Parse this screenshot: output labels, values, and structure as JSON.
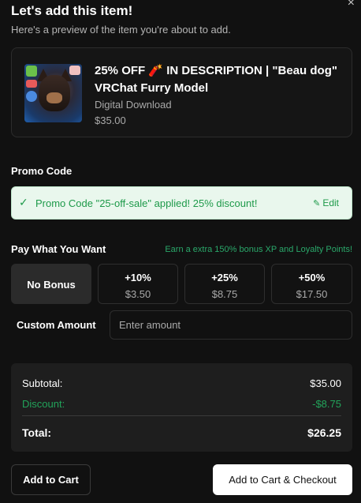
{
  "dialog": {
    "close_glyph": "×",
    "title": "Let's add this item!",
    "subtitle": "Here's a preview of the item you're about to add."
  },
  "item": {
    "title_prefix": "25% OFF ",
    "title_emoji": "🧨",
    "title_suffix": " IN DESCRIPTION | \"Beau dog\" VRChat Furry Model",
    "type": "Digital Download",
    "price": "$35.00",
    "thumbnail_icon": "dog-avatar-thumbnail"
  },
  "promo": {
    "label": "Promo Code",
    "status_icon": "check-icon",
    "message": "Promo Code \"25-off-sale\" applied! 25% discount!",
    "edit_label": "Edit",
    "edit_icon": "pencil-icon"
  },
  "pwyw": {
    "label": "Pay What You Want",
    "hint": "Earn a extra 150% bonus XP and Loyalty Points!",
    "options": [
      {
        "label": "No Bonus",
        "amount": "",
        "selected": true
      },
      {
        "label": "+10%",
        "amount": "$3.50",
        "selected": false
      },
      {
        "label": "+25%",
        "amount": "$8.75",
        "selected": false
      },
      {
        "label": "+50%",
        "amount": "$17.50",
        "selected": false
      }
    ],
    "custom_label": "Custom Amount",
    "custom_placeholder": "Enter amount",
    "custom_value": ""
  },
  "summary": {
    "subtotal_label": "Subtotal:",
    "subtotal_value": "$35.00",
    "discount_label": "Discount:",
    "discount_value": "-$8.75",
    "total_label": "Total:",
    "total_value": "$26.25"
  },
  "actions": {
    "add_to_cart": "Add to Cart",
    "add_and_checkout": "Add to Cart & Checkout"
  },
  "colors": {
    "background": "#111111",
    "success_green": "#22a35a",
    "promo_bg": "#e9f7ed"
  }
}
